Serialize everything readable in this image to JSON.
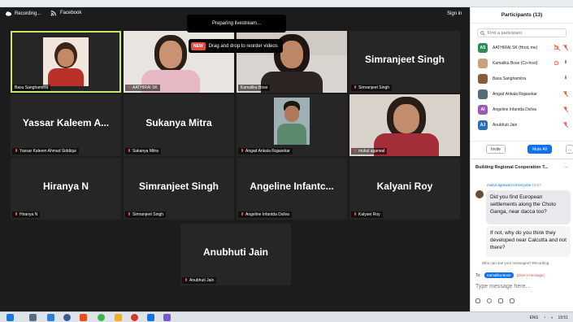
{
  "topbar": {
    "recording_label": "Recording...",
    "facebook_label": "Facebook",
    "signin_label": "Sign in"
  },
  "toasts": {
    "livestream": "Preparing livestream...",
    "new_badge": "NEW",
    "reorder": "Drag and drop to reorder videos"
  },
  "tiles": [
    {
      "display": "",
      "label": "Basu Sanghamitra",
      "has_video": true
    },
    {
      "display": "",
      "label": "AATHIRAI SK",
      "has_video": true
    },
    {
      "display": "",
      "label": "Kamalika Bose",
      "has_video": true
    },
    {
      "display": "Simranjeet Singh",
      "label": "Simranjeet Singh",
      "has_video": false
    },
    {
      "display": "Yassar Kaleem A...",
      "label": "Yassar Kaleem Ahmad Siddiqui",
      "has_video": false
    },
    {
      "display": "Sukanya Mitra",
      "label": "Sukanya Mitra",
      "has_video": false
    },
    {
      "display": "",
      "label": "Angad Ankala Rajasekar",
      "has_video": true
    },
    {
      "display": "",
      "label": "mukul agarwal",
      "has_video": true
    },
    {
      "display": "Hiranya N",
      "label": "Hiranya N",
      "has_video": false
    },
    {
      "display": "Simranjeet Singh",
      "label": "Simranjeet Singh",
      "has_video": false
    },
    {
      "display": "Angeline Infantc...",
      "label": "Angeline Infantda Dsilva",
      "has_video": false
    },
    {
      "display": "Kalyani Roy",
      "label": "Kalyani Roy",
      "has_video": false
    },
    {
      "display": "Anubhuti Jain",
      "label": "Anubhuti Jain",
      "has_video": false
    }
  ],
  "participants": {
    "title": "Participants (13)",
    "search_placeholder": "Find a participant",
    "items": [
      {
        "initials": "AS",
        "name": "AATHIRAI SK (Host, me)",
        "color": "#2e8b57"
      },
      {
        "initials": "",
        "name": "Kamalika Bose (Co-host)",
        "color": "#c9a27e"
      },
      {
        "initials": "",
        "name": "Basu Sanghamitra",
        "color": "#8a5a3b"
      },
      {
        "initials": "",
        "name": "Angad Ankala Rajasekar",
        "color": "#556b7a"
      },
      {
        "initials": "AI",
        "name": "Angeline Infantda Dsilva",
        "color": "#9b59b6"
      },
      {
        "initials": "AJ",
        "name": "Anubhuti Jain",
        "color": "#2f6fb8"
      }
    ],
    "invite_label": "Invite",
    "mute_all_label": "Mute All"
  },
  "chat": {
    "title": "Building Regional Cooperation T...",
    "from": "mukul agarwal to Everyone",
    "time": "19:47",
    "message1": "Did you find European settlements  along the Choto Ganga, near dacca too?",
    "message2": "If not, why do you think they developed near Calcutta and not there?",
    "who_can_see": "Who can see your messages? Recording",
    "to_label": "To:",
    "to_recipient": "Kamalika Bose",
    "direct_label": "(Direct message)",
    "input_placeholder": "Type message here..."
  },
  "taskbar": {
    "lang": "ENG",
    "time": "19:51"
  }
}
